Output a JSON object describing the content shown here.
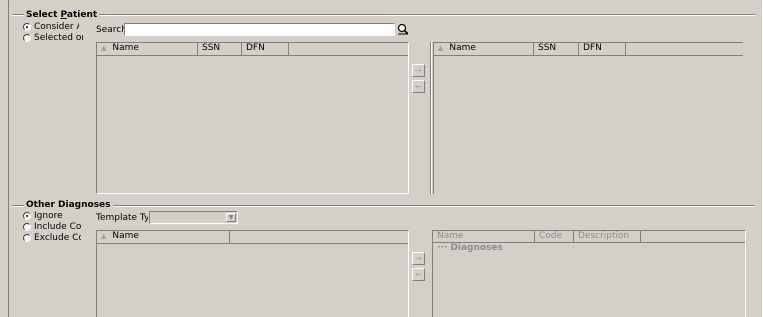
{
  "select_patient": {
    "legend": "Select Patient",
    "legend_underline": "P",
    "options": [
      {
        "label": "Consider All",
        "checked": true
      },
      {
        "label": "Selected only",
        "checked": false
      }
    ],
    "search_label": "Search",
    "search_value": "",
    "search_icon": "magnifier-icon",
    "available_columns": [
      "Name",
      "SSN",
      "DFN"
    ],
    "selected_columns": [
      "Name",
      "SSN",
      "DFN"
    ],
    "move_right_label": "→",
    "move_left_label": "←"
  },
  "other_diagnoses": {
    "legend": "Other Diagnoses",
    "options": [
      {
        "label": "Ignore",
        "checked": true
      },
      {
        "label": "Include Codes",
        "checked": false
      },
      {
        "label": "Exclude Codes",
        "checked": false
      }
    ],
    "template_label": "Template Type",
    "template_value": "",
    "available_columns": [
      "Name"
    ],
    "selected_columns": [
      "Name",
      "Code",
      "Description"
    ],
    "tree_root": "Diagnoses",
    "move_right_label": "→",
    "move_left_label": "←"
  }
}
